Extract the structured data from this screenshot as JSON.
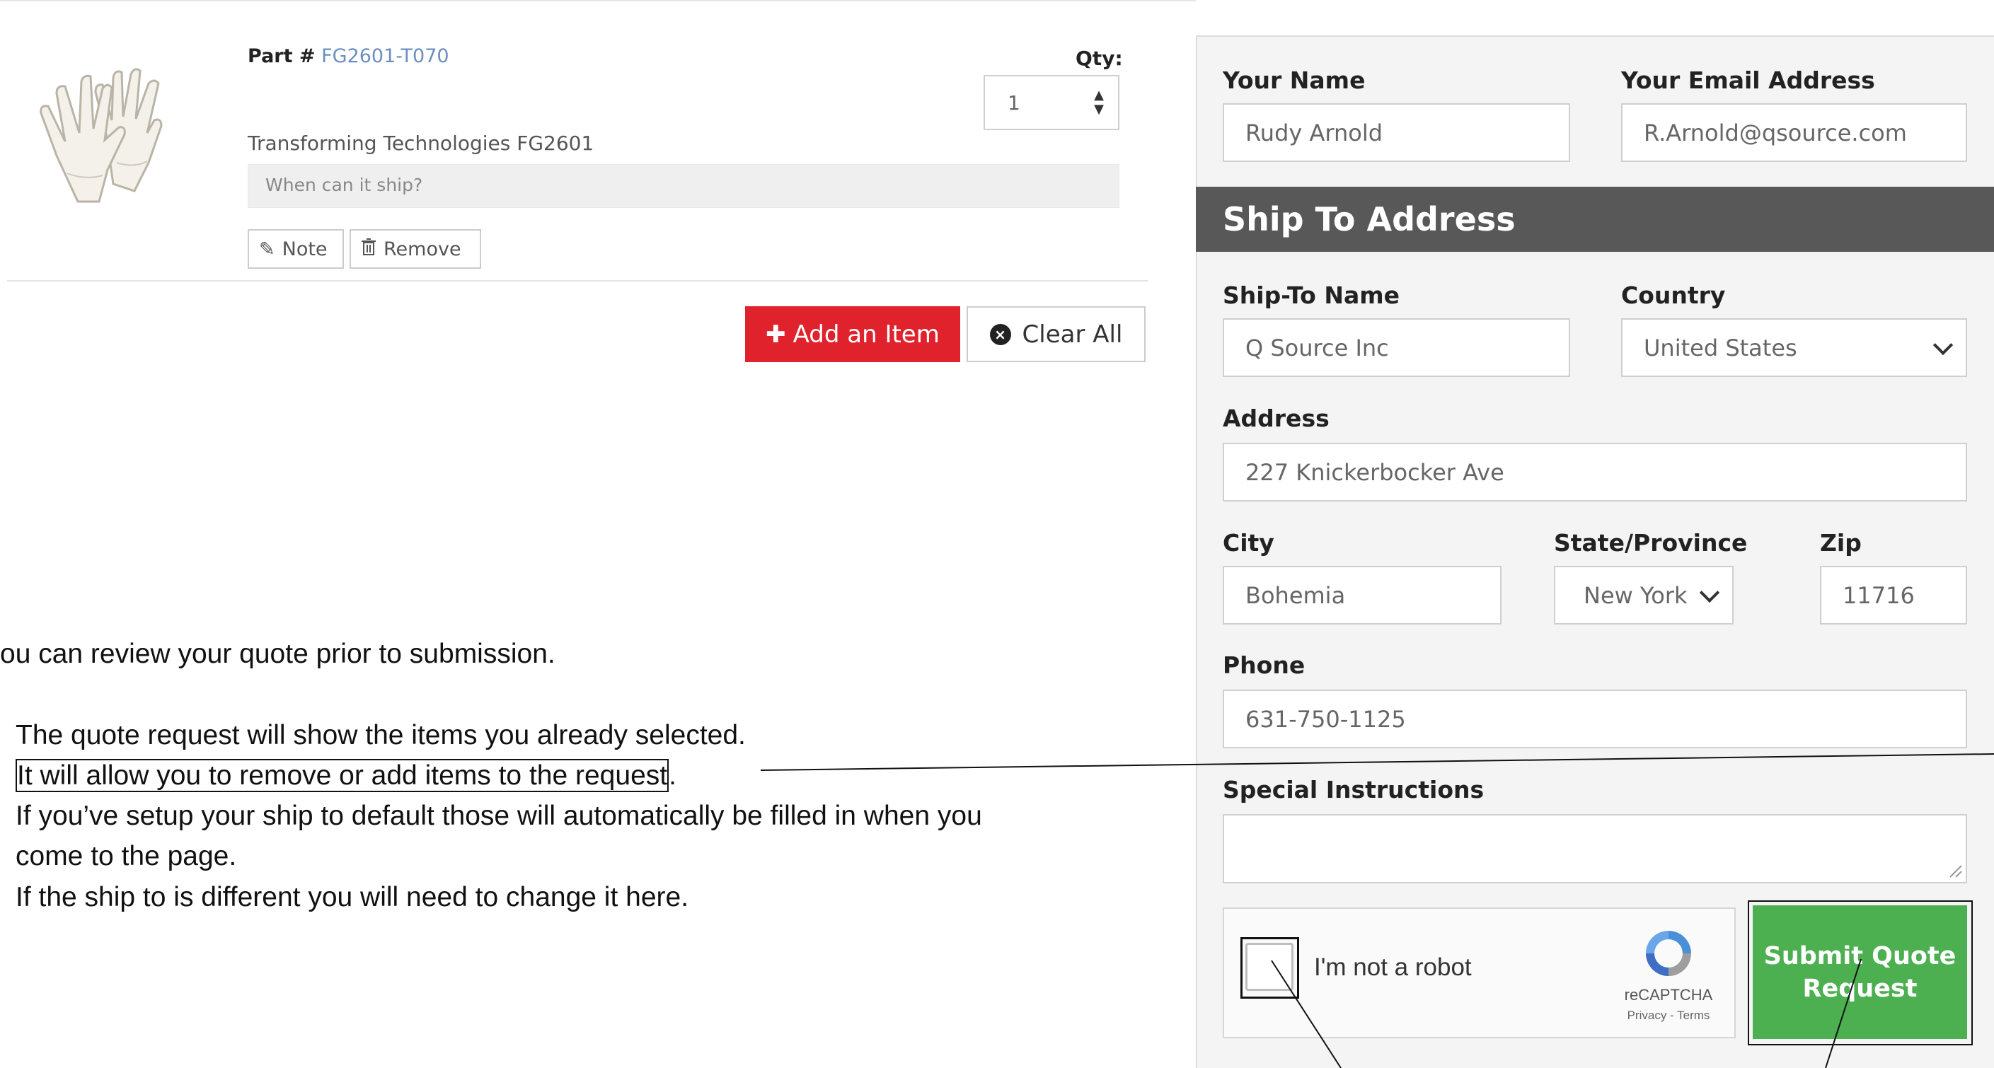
{
  "cart": {
    "item": {
      "part_label": "Part #",
      "part_number": "FG2601-T070",
      "qty_label": "Qty:",
      "qty_value": "1",
      "description": "Transforming Technologies FG2601",
      "ship_placeholder": "When can it ship?",
      "note_label": "Note",
      "remove_label": "Remove"
    },
    "add_item_label": "Add an Item",
    "clear_all_label": "Clear All"
  },
  "annotations": {
    "intro": "ou can review your quote prior to submission.",
    "line1": "The quote request will show the items you already selected.",
    "line2_boxed": "It will allow you to remove or add items to the request",
    "line2_tail": ".",
    "line3a": "If you’ve setup your ship to default those will automatically be filled in when you",
    "line3b": "come to the page.",
    "line4": "If the ship to is different you will need to change it here."
  },
  "form": {
    "your_name_label": "Your Name",
    "your_name_value": "Rudy Arnold",
    "email_label": "Your Email Address",
    "email_value": "R.Arnold@qsource.com",
    "ship_to_header": "Ship To Address",
    "ship_to_name_label": "Ship-To Name",
    "ship_to_name_value": "Q Source Inc",
    "country_label": "Country",
    "country_value": "United States",
    "address_label": "Address",
    "address_value": "227 Knickerbocker Ave",
    "city_label": "City",
    "city_value": "Bohemia",
    "state_label": "State/Province",
    "state_value": "New York",
    "zip_label": "Zip",
    "zip_value": "11716",
    "phone_label": "Phone",
    "phone_value": "631-750-1125",
    "special_label": "Special Instructions",
    "special_value": "",
    "captcha_label": "I'm not a robot",
    "captcha_brand": "reCAPTCHA",
    "captcha_links": "Privacy - Terms",
    "submit_label": "Submit Quote Request"
  },
  "colors": {
    "add_button": "#e0222d",
    "submit_button": "#4caf50",
    "ship_header": "#585858",
    "part_link": "#6a8fbf"
  }
}
